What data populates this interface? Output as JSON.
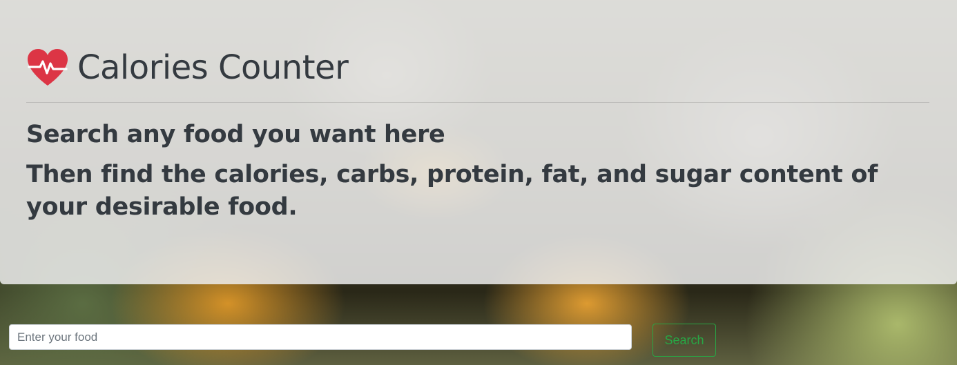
{
  "header": {
    "title": "Calories Counter",
    "icon": "heartbeat-icon",
    "icon_color": "#dc3545"
  },
  "intro": {
    "line1": "Search any food you want here",
    "line2": "Then find the calories, carbs, protein, fat, and sugar content of your desirable food."
  },
  "search": {
    "placeholder": "Enter your food",
    "value": "",
    "button_label": "Search",
    "button_color": "#28a745"
  }
}
